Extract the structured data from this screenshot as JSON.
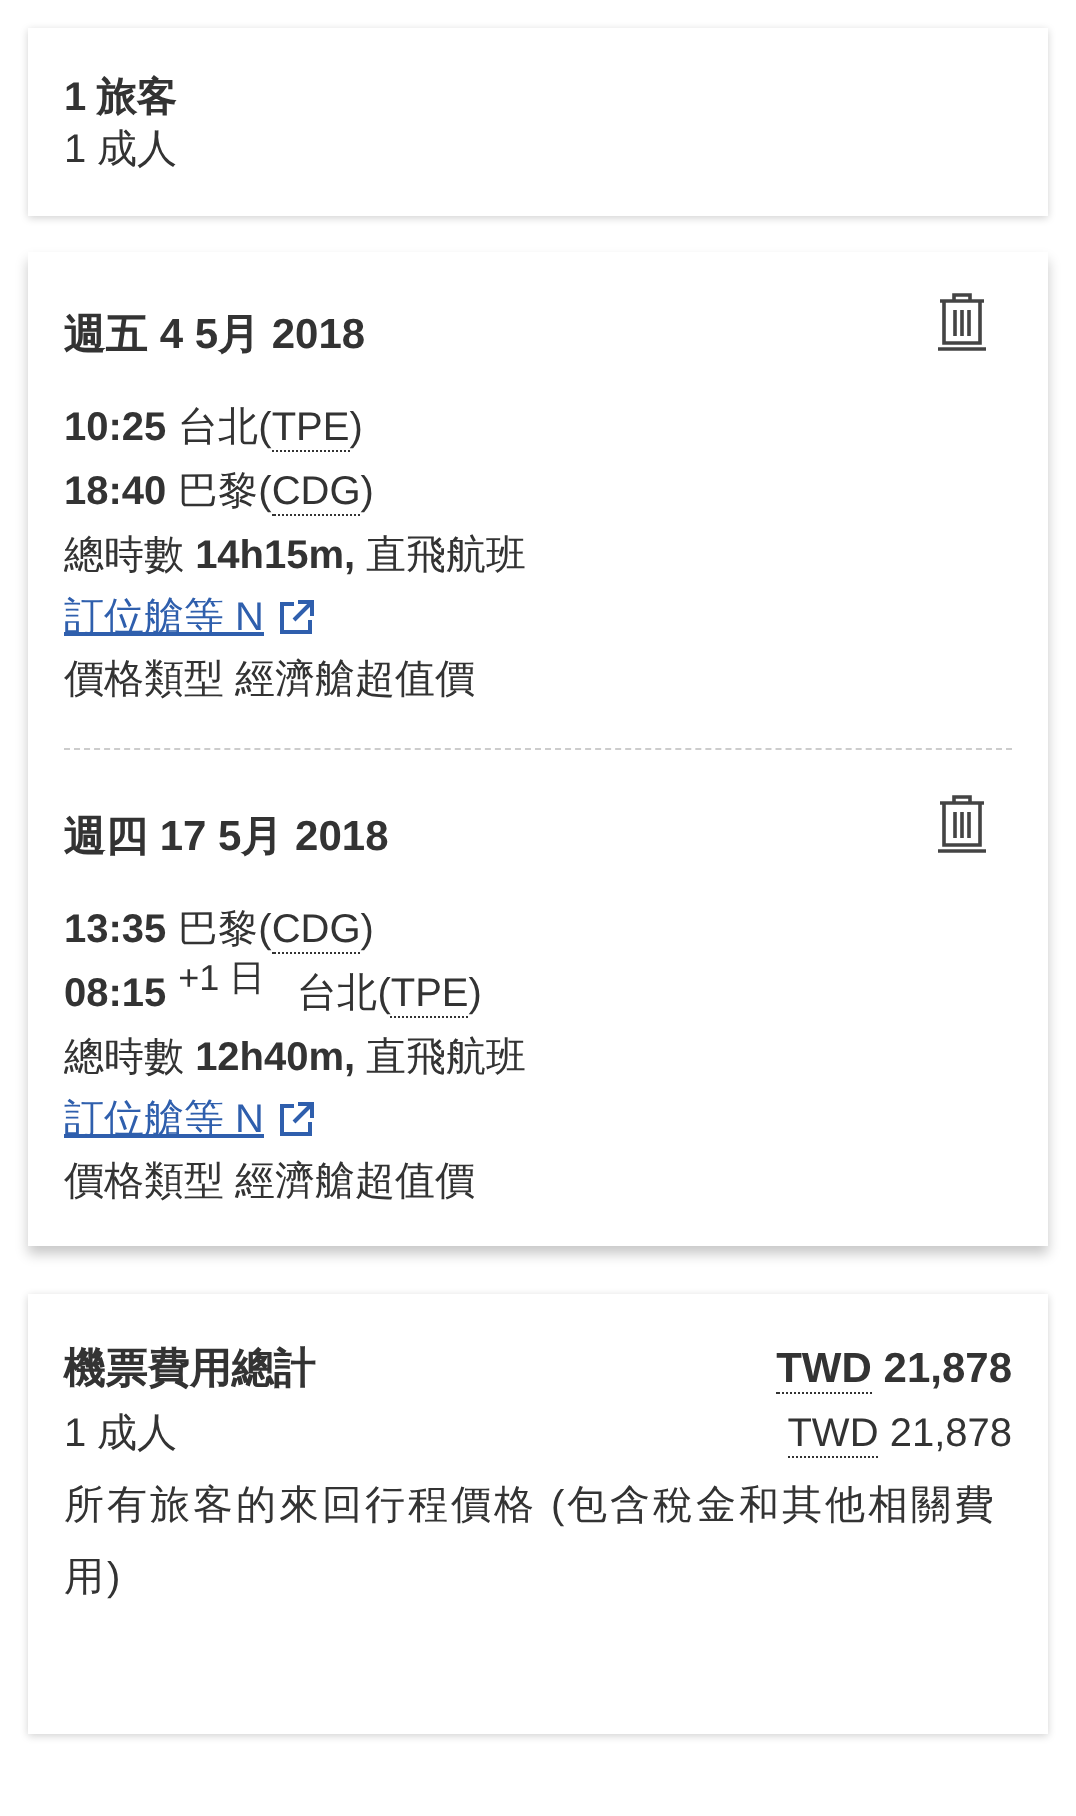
{
  "travelers": {
    "title": "1 旅客",
    "detail": "1 成人"
  },
  "segments": [
    {
      "date": "週五 4 5月 2018",
      "departure": {
        "time": "10:25",
        "place_before": "台北(",
        "code": "TPE",
        "place_after": ")"
      },
      "arrival": {
        "time": "18:40",
        "place_before": "巴黎(",
        "code": "CDG",
        "place_after": ")"
      },
      "duration": "總時數 **14h15m,** 直飛航班",
      "booking_link": "訂位艙等 N",
      "fare": "價格類型 經濟艙超值價"
    },
    {
      "date": "週四 17 5月 2018",
      "departure": {
        "time": "13:35",
        "place_before": "巴黎(",
        "code": "CDG",
        "place_after": ")"
      },
      "arrival": {
        "time": "08:15",
        "day_offset": "+1 日",
        "place_before": "台北(",
        "code": "TPE",
        "place_after": ")"
      },
      "duration": "總時數 **12h40m,** 直飛航班",
      "booking_link": "訂位艙等 N",
      "fare": "價格類型 經濟艙超值價"
    }
  ],
  "total": {
    "label": "機票費用總計",
    "currency": "TWD",
    "amount": "21,878",
    "rows": [
      {
        "label": "1 成人",
        "currency": "TWD",
        "amount": "21,878"
      }
    ],
    "note": "所有旅客的來回行程價格 (包含稅金和其他相關費用)"
  }
}
